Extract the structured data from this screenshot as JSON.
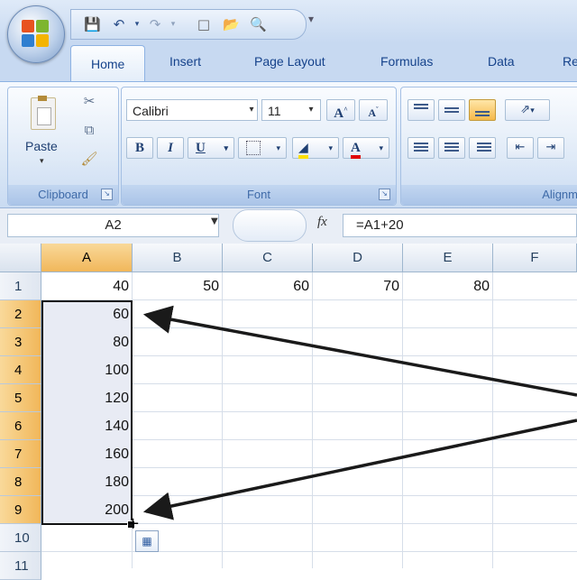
{
  "quick_access": {
    "icons": [
      "save-icon",
      "undo-icon",
      "redo-icon",
      "new-icon",
      "open-icon",
      "print-preview-icon",
      "customize-icon"
    ]
  },
  "tabs": [
    "Home",
    "Insert",
    "Page Layout",
    "Formulas",
    "Data",
    "Re"
  ],
  "ribbon": {
    "clipboard": {
      "label": "Clipboard",
      "paste_label": "Paste"
    },
    "font": {
      "label": "Font",
      "font_name": "Calibri",
      "font_size": "11"
    },
    "alignment": {
      "label": "Alignm"
    }
  },
  "formula_bar": {
    "name_box": "A2",
    "fx": "fx",
    "formula": "=A1+20"
  },
  "columns": [
    "A",
    "B",
    "C",
    "D",
    "E",
    "F"
  ],
  "rows": [
    "1",
    "2",
    "3",
    "4",
    "5",
    "6",
    "7",
    "8",
    "9",
    "10",
    "11"
  ],
  "cells": {
    "row1": [
      "40",
      "50",
      "60",
      "70",
      "80"
    ],
    "colA": [
      "60",
      "80",
      "100",
      "120",
      "140",
      "160",
      "180",
      "200"
    ]
  },
  "selection": {
    "range": "A2:A9",
    "active": "A2"
  },
  "colors": {
    "selected_header": "#f1b75a",
    "selection_fill": "#e8ebf4",
    "ribbon_blue": "#c7d9f1",
    "annotation_arrow": "#1a1a1a"
  }
}
